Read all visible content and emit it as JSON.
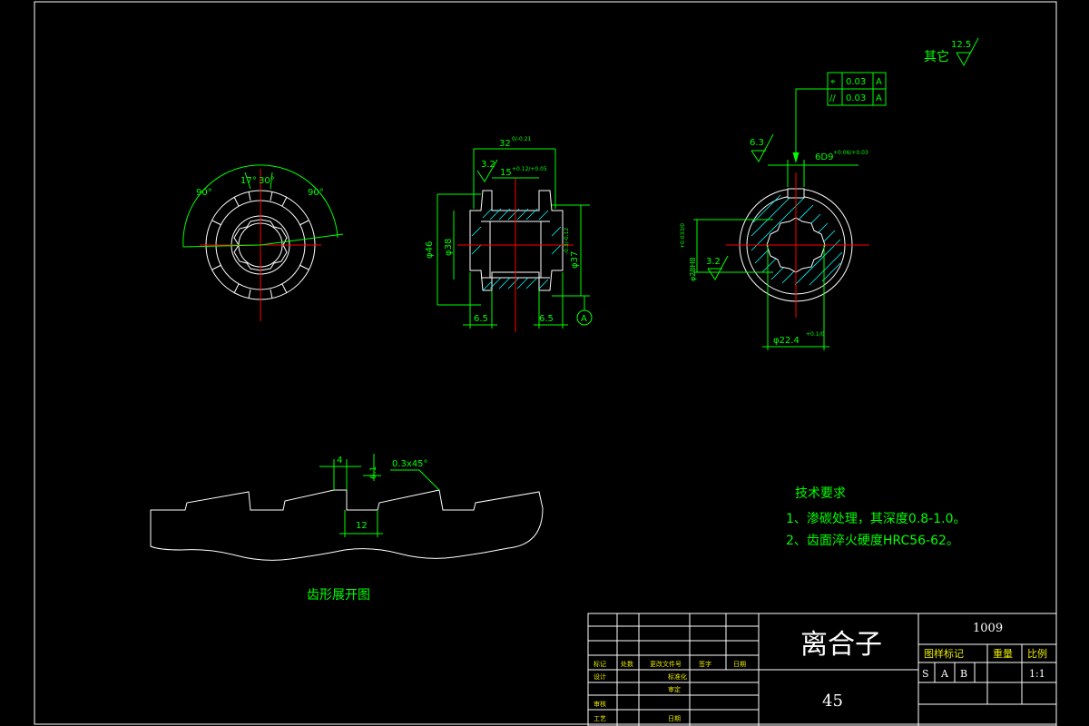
{
  "colors": {
    "background": "#000000",
    "outline": "#ffffff",
    "dimension": "#00ff00",
    "centerline": "#ff0000",
    "hatch": "#00ffff",
    "title_block_small": "#e8e800"
  },
  "other_roughness": {
    "label": "其它",
    "value": "12.5"
  },
  "view_left": {
    "angle_left": "90°",
    "angle_mid_left": "17°",
    "angle_mid_right": "30°",
    "angle_right": "90°"
  },
  "view_section": {
    "dim_top": "32",
    "dim_top_tol": "0/-0.21",
    "dim_inner": "15",
    "dim_inner_tol": "+0.12/+0.05",
    "roughness": "3.2",
    "dia_outer": "φ46",
    "dia_hub": "φ38",
    "dia_right": "φ37",
    "dia_right_tol": "-0.3/-0.12",
    "width_left": "6.5",
    "width_right": "6.5",
    "datum": "A"
  },
  "view_right": {
    "fcf_row1_symbol": "⌖",
    "fcf_row1_value": "0.03",
    "fcf_row1_datum": "A",
    "fcf_row2_symbol": "//",
    "fcf_row2_value": "0.03",
    "fcf_row2_datum": "A",
    "roughness_top": "6.3",
    "dim_top": "6D9",
    "dim_top_tol": "+0.06/+0.03",
    "roughness_left": "3.2",
    "dia_left": "φ28H8",
    "dia_left_tol": "+0.033/0",
    "dia_bottom": "φ22.4",
    "dia_bottom_tol": "+0.1/0"
  },
  "tooth_profile": {
    "dim_4": "4",
    "dim_small": "6.1",
    "dim_12": "12",
    "chamfer": "0.3x45°",
    "caption": "齿形展开图"
  },
  "technical_requirements": {
    "title": "技术要求",
    "item1": "1、渗碳处理，其深度0.8-1.0。",
    "item2": "2、齿面淬火硬度HRC56-62。"
  },
  "title_block": {
    "part_name": "离合子",
    "material": "45",
    "drawing_no": "1009",
    "stage_label": "图样标记",
    "weight_label": "重量",
    "scale_label": "比例",
    "stage_s": "S",
    "stage_a": "A",
    "stage_b": "B",
    "scale": "1:1",
    "row_mark": "标记",
    "row_count": "处数",
    "row_doc": "更改文件号",
    "row_sign": "签字",
    "row_date": "日期",
    "row_design": "设计",
    "row_standard": "标准化",
    "row_review": "审核",
    "row_check": "审定",
    "row_craft": "工艺",
    "row_date2": "日期"
  }
}
